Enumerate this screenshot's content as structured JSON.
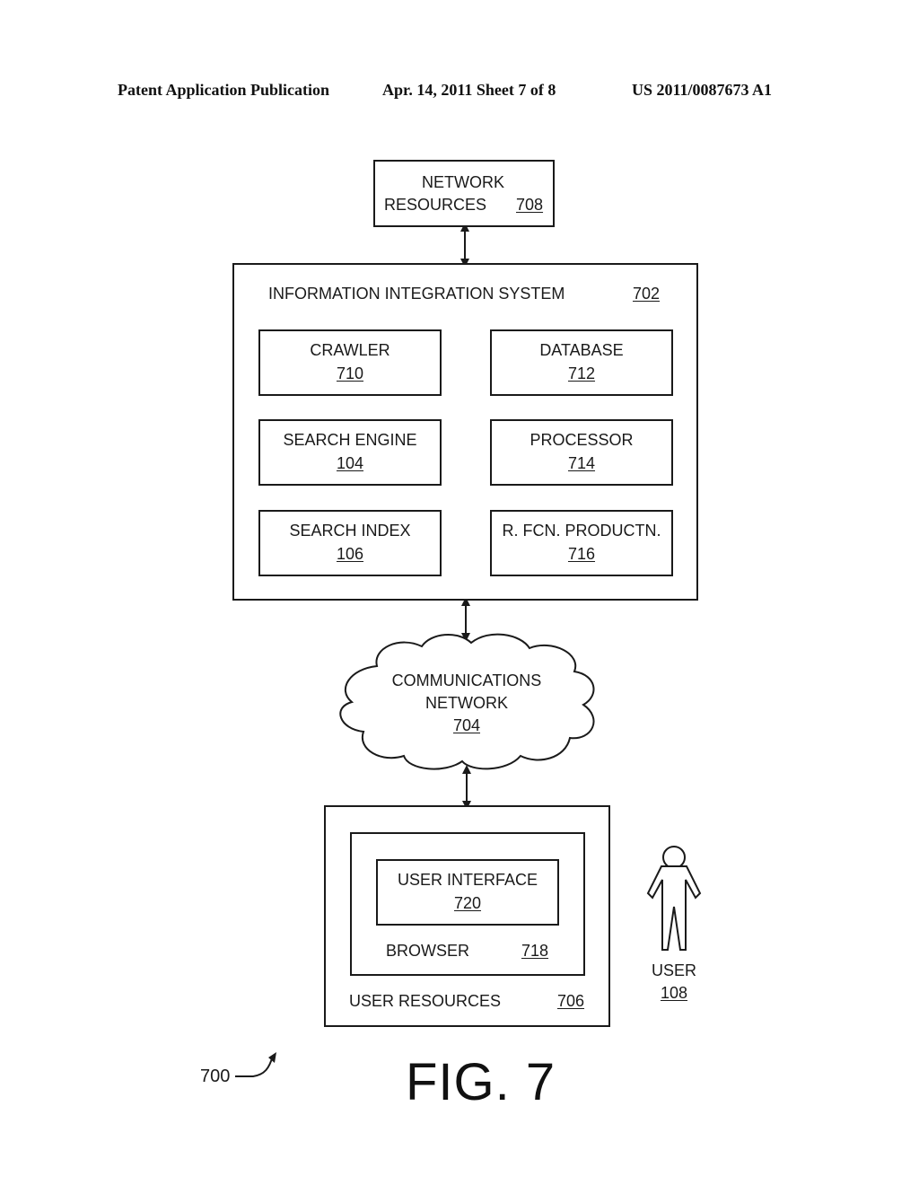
{
  "header": {
    "publication": "Patent Application Publication",
    "date_sheet": "Apr. 14, 2011  Sheet 7 of 8",
    "patent_number": "US 2011/0087673 A1"
  },
  "network_resources": {
    "label_line1": "NETWORK",
    "label_line2": "RESOURCES",
    "ref": "708"
  },
  "integration_system": {
    "title": "INFORMATION INTEGRATION SYSTEM",
    "ref": "702",
    "components": [
      {
        "label": "CRAWLER",
        "ref": "710"
      },
      {
        "label": "DATABASE",
        "ref": "712"
      },
      {
        "label": "SEARCH ENGINE",
        "ref": "104"
      },
      {
        "label": "PROCESSOR",
        "ref": "714"
      },
      {
        "label": "SEARCH INDEX",
        "ref": "106"
      },
      {
        "label": "R. FCN. PRODUCTN.",
        "ref": "716"
      }
    ]
  },
  "network": {
    "label_line1": "COMMUNICATIONS",
    "label_line2": "NETWORK",
    "ref": "704"
  },
  "user_resources": {
    "label": "USER RESOURCES",
    "ref": "706",
    "browser": {
      "label": "BROWSER",
      "ref": "718"
    },
    "user_interface": {
      "label": "USER INTERFACE",
      "ref": "720"
    }
  },
  "user": {
    "label": "USER",
    "ref": "108"
  },
  "figure": {
    "ref": "700",
    "caption": "FIG. 7"
  }
}
